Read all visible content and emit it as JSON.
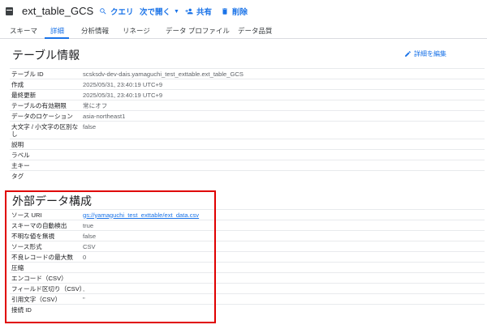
{
  "toolbar": {
    "title": "ext_table_GCS",
    "query": "クエリ",
    "open_next": "次で開く",
    "share": "共有",
    "delete": "削除"
  },
  "tabs": [
    "スキーマ",
    "詳細",
    "分析情報",
    "リネージ",
    "データ プロファイル",
    "データ品質"
  ],
  "table_info": {
    "title": "テーブル情報",
    "edit": "詳細を編集",
    "rows": [
      {
        "k": "テーブル ID",
        "v": "scsksdv-dev-dais.yamaguchi_test_exttable.ext_table_GCS"
      },
      {
        "k": "作成",
        "v": "2025/05/31, 23:40:19 UTC+9"
      },
      {
        "k": "最終更新",
        "v": "2025/05/31, 23:40:19 UTC+9"
      },
      {
        "k": "テーブルの有効期限",
        "v": "常にオフ"
      },
      {
        "k": "データのロケーション",
        "v": "asia-northeast1"
      },
      {
        "k": "大文字 / 小文字の区別なし",
        "v": "false"
      },
      {
        "k": "説明",
        "v": ""
      },
      {
        "k": "ラベル",
        "v": ""
      },
      {
        "k": "主キー",
        "v": ""
      },
      {
        "k": "タグ",
        "v": ""
      }
    ]
  },
  "external": {
    "title": "外部データ構成",
    "rows": [
      {
        "k": "ソース URI",
        "v": "gs://yamaguchi_test_exttable/ext_data.csv",
        "link": true
      },
      {
        "k": "スキーマの自動検出",
        "v": "true"
      },
      {
        "k": "不明な値を無視",
        "v": "false"
      },
      {
        "k": "ソース形式",
        "v": "CSV"
      },
      {
        "k": "不良レコードの最大数",
        "v": "0"
      },
      {
        "k": "圧縮",
        "v": ""
      },
      {
        "k": "エンコード（CSV）",
        "v": ""
      },
      {
        "k": "フィールド区切り（CSV）",
        "v": ","
      },
      {
        "k": "引用文字（CSV）",
        "v": "\""
      },
      {
        "k": "接続 ID",
        "v": ""
      }
    ]
  }
}
